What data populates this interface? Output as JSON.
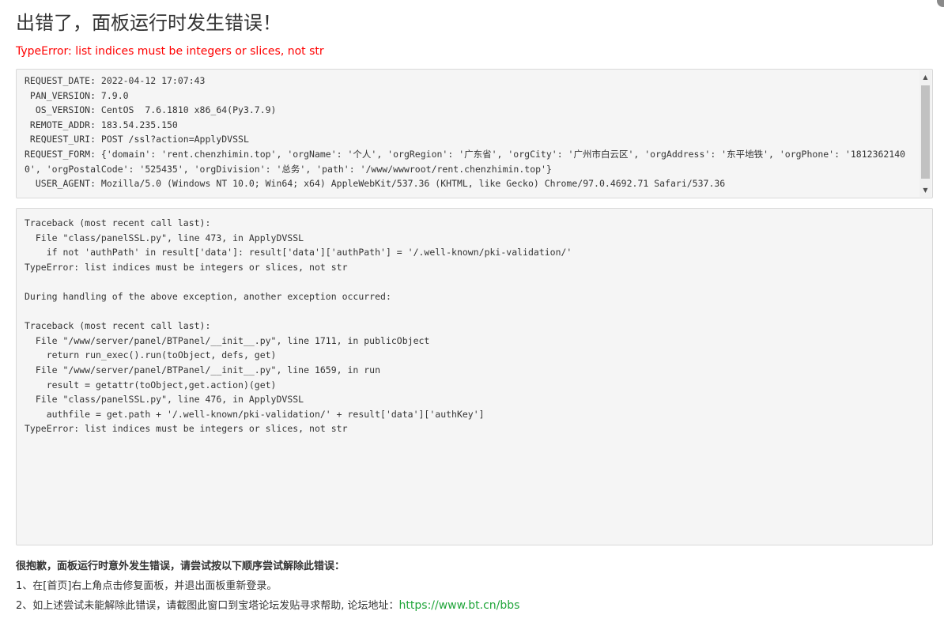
{
  "page": {
    "title": "出错了，面板运行时发生错误！",
    "error_summary": "TypeError: list indices must be integers or slices, not str"
  },
  "request_info": {
    "lines": [
      "REQUEST_DATE: 2022-04-12 17:07:43",
      " PAN_VERSION: 7.9.0",
      "  OS_VERSION: CentOS  7.6.1810 x86_64(Py3.7.9)",
      " REMOTE_ADDR: 183.54.235.150",
      " REQUEST_URI: POST /ssl?action=ApplyDVSSL",
      "REQUEST_FORM: {'domain': 'rent.chenzhimin.top', 'orgName': '个人', 'orgRegion': '广东省', 'orgCity': '广州市白云区', 'orgAddress': '东平地铁', 'orgPhone': '18123621400', 'orgPostalCode': '525435', 'orgDivision': '总务', 'path': '/www/wwwroot/rent.chenzhimin.top'}",
      "  USER_AGENT: Mozilla/5.0 (Windows NT 10.0; Win64; x64) AppleWebKit/537.36 (KHTML, like Gecko) Chrome/97.0.4692.71 Safari/537.36"
    ],
    "scrollbar": {
      "up_icon": "scroll-up-arrow-icon",
      "down_icon": "scroll-down-arrow-icon"
    }
  },
  "traceback": {
    "lines": [
      "Traceback (most recent call last):",
      "  File \"class/panelSSL.py\", line 473, in ApplyDVSSL",
      "    if not 'authPath' in result['data']: result['data']['authPath'] = '/.well-known/pki-validation/'",
      "TypeError: list indices must be integers or slices, not str",
      "",
      "During handling of the above exception, another exception occurred:",
      "",
      "Traceback (most recent call last):",
      "  File \"/www/server/panel/BTPanel/__init__.py\", line 1711, in publicObject",
      "    return run_exec().run(toObject, defs, get)",
      "  File \"/www/server/panel/BTPanel/__init__.py\", line 1659, in run",
      "    result = getattr(toObject,get.action)(get)",
      "  File \"class/panelSSL.py\", line 476, in ApplyDVSSL",
      "    authfile = get.path + '/.well-known/pki-validation/' + result['data']['authKey']",
      "TypeError: list indices must be integers or slices, not str"
    ]
  },
  "help": {
    "title": "很抱歉，面板运行时意外发生错误，请尝试按以下顺序尝试解除此错误：",
    "step1": "1、在[首页]右上角点击修复面板，并退出面板重新登录。",
    "step2_text": "2、如上述尝试未能解除此错误，请截图此窗口到宝塔论坛发贴寻求帮助, 论坛地址：",
    "forum_link": "https://www.bt.cn/bbs"
  },
  "colors": {
    "error_red": "#ff0000",
    "link_green": "#20a53a",
    "box_background": "#f5f5f5"
  }
}
